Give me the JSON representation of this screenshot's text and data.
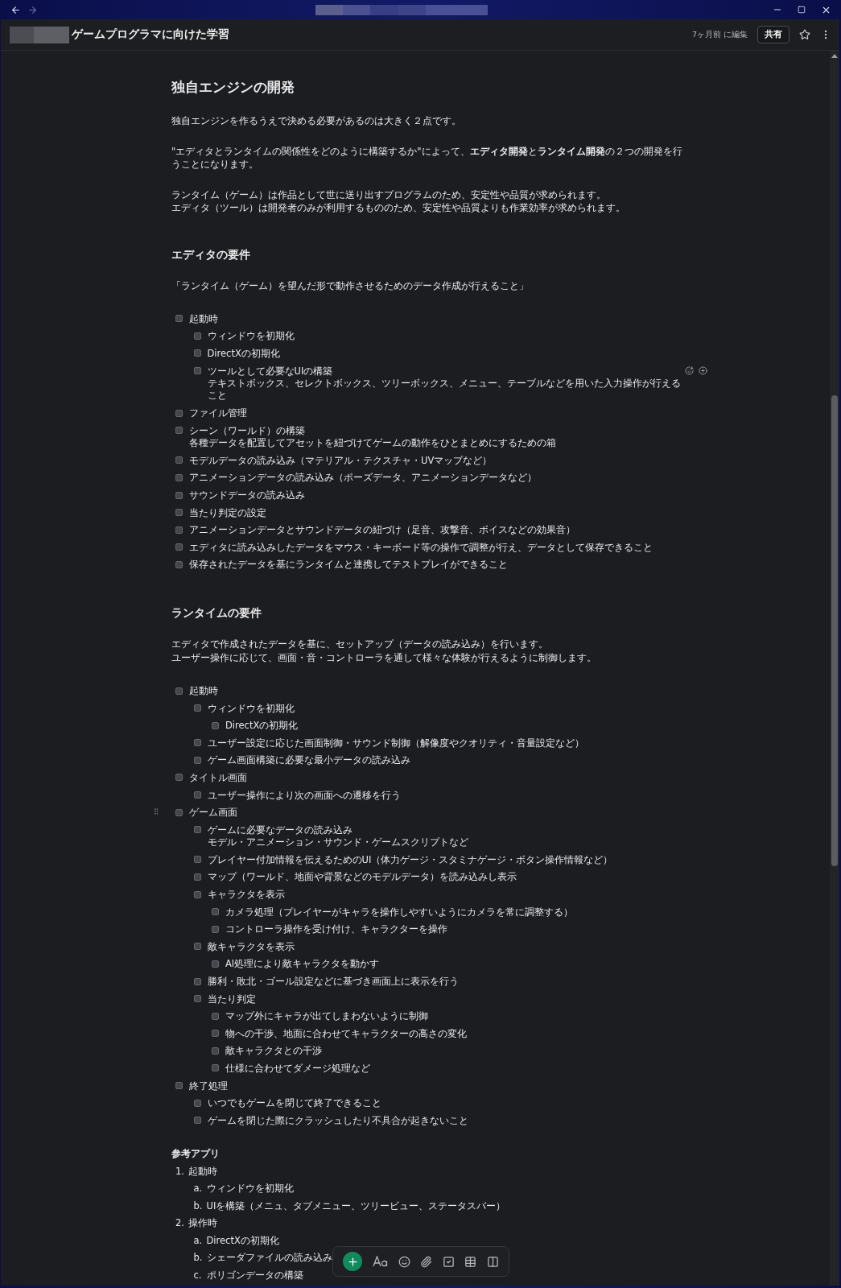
{
  "window": {
    "back_enabled": true,
    "forward_enabled": false
  },
  "header": {
    "title": "ゲームプログラマに向けた学習",
    "edited": "7ヶ月前 に編集",
    "share": "共有"
  },
  "document": {
    "blocks": [
      {
        "kind": "h1",
        "text": "独自エンジンの開発"
      },
      {
        "kind": "paragraph",
        "lines": [
          "独自エンジンを作るうえで決める必要があるのは大きく２点です。"
        ]
      },
      {
        "kind": "paragraph",
        "lines": [
          "\"エディタとランタイムの関係性をどのように構築するか\"によって、**エディタ開発**と**ランタイム開発**の２つの開発を行",
          "うことになります。"
        ]
      },
      {
        "kind": "paragraph",
        "lines": [
          "ランタイム（ゲーム）は作品として世に送り出すプログラムのため、安定性や品質が求められます。",
          "エディタ（ツール）は開発者のみが利用するもののため、安定性や品質よりも作業効率が求められます。"
        ]
      },
      {
        "kind": "h2",
        "text": "エディタの要件"
      },
      {
        "kind": "paragraph",
        "lines": [
          "「ランタイム（ゲーム）を望んだ形で動作させるためのデータ作成が行えること」"
        ]
      },
      {
        "kind": "checklist",
        "items": [
          {
            "text": "起動時",
            "checked": false,
            "children": [
              {
                "text": "ウィンドウを初期化",
                "checked": false
              },
              {
                "text": "DirectXの初期化",
                "checked": false
              },
              {
                "text": "ツールとして必要なUIの構築",
                "detail": [
                  "テキストボックス、セレクトボックス、ツリーボックス、メニュー、テーブルなどを用いた入力操作が行える",
                  "こと"
                ],
                "checked": false,
                "tools_shown": true
              }
            ]
          },
          {
            "text": "ファイル管理",
            "checked": false
          },
          {
            "text": "シーン（ワールド）の構築",
            "detail": [
              "各種データを配置してアセットを紐づけてゲームの動作をひとまとめにするための箱"
            ],
            "checked": false
          },
          {
            "text": "モデルデータの読み込み（マテリアル・テクスチャ・UVマップなど）",
            "checked": false
          },
          {
            "text": "アニメーションデータの読み込み（ポーズデータ、アニメーションデータなど）",
            "checked": false
          },
          {
            "text": "サウンドデータの読み込み",
            "checked": false
          },
          {
            "text": "当たり判定の設定",
            "checked": false
          },
          {
            "text": "アニメーションデータとサウンドデータの紐づけ（足音、攻撃音、ボイスなどの効果音）",
            "checked": false
          },
          {
            "text": "エディタに読み込みしたデータをマウス・キーボード等の操作で調整が行え、データとして保存できること",
            "checked": false
          },
          {
            "text": "保存されたデータを基にランタイムと連携してテストプレイができること",
            "checked": false
          }
        ]
      },
      {
        "kind": "h2",
        "text": "ランタイムの要件"
      },
      {
        "kind": "paragraph",
        "lines": [
          "エディタで作成されたデータを基に、セットアップ（データの読み込み）を行います。",
          "ユーザー操作に応じて、画面・音・コントローラを通して様々な体験が行えるように制御します。"
        ]
      },
      {
        "kind": "checklist",
        "items": [
          {
            "text": "起動時",
            "checked": false,
            "children": [
              {
                "text": "ウィンドウを初期化",
                "checked": false,
                "children": [
                  {
                    "text": "DirectXの初期化",
                    "checked": false
                  }
                ]
              },
              {
                "text": "ユーザー設定に応じた画面制御・サウンド制御（解像度やクオリティ・音量設定など）",
                "checked": false
              },
              {
                "text": "ゲーム画面構築に必要な最小データの読み込み",
                "checked": false
              }
            ]
          },
          {
            "text": "タイトル画面",
            "checked": false,
            "children": [
              {
                "text": "ユーザー操作により次の画面への遷移を行う",
                "checked": false
              }
            ]
          },
          {
            "text": "ゲーム画面",
            "checked": false,
            "hovered": true,
            "children": [
              {
                "text": "ゲームに必要なデータの読み込み",
                "detail": [
                  "モデル・アニメーション・サウンド・ゲームスクリプトなど"
                ],
                "checked": false
              },
              {
                "text": "プレイヤー付加情報を伝えるためのUI（体力ゲージ・スタミナゲージ・ボタン操作情報など）",
                "checked": false
              },
              {
                "text": "マップ（ワールド、地面や背景などのモデルデータ）を読み込みし表示",
                "checked": false
              },
              {
                "text": "キャラクタを表示",
                "checked": false,
                "children": [
                  {
                    "text": "カメラ処理（プレイヤーがキャラを操作しやすいようにカメラを常に調整する）",
                    "checked": false
                  },
                  {
                    "text": "コントローラ操作を受け付け、キャラクターを操作",
                    "checked": false
                  }
                ]
              },
              {
                "text": "敵キャラクタを表示",
                "checked": false,
                "children": [
                  {
                    "text": "AI処理により敵キャラクタを動かす",
                    "checked": false
                  }
                ]
              },
              {
                "text": "勝利・敗北・ゴール設定などに基づき画面上に表示を行う",
                "checked": false
              },
              {
                "text": "当たり判定",
                "checked": false,
                "children": [
                  {
                    "text": "マップ外にキャラが出てしまわないように制御",
                    "checked": false
                  },
                  {
                    "text": "物への干渉、地面に合わせてキャラクターの高さの変化",
                    "checked": false
                  },
                  {
                    "text": "敵キャラクタとの干渉",
                    "checked": false
                  },
                  {
                    "text": "仕様に合わせてダメージ処理など",
                    "checked": false
                  }
                ]
              }
            ]
          },
          {
            "text": "終了処理",
            "checked": false,
            "children": [
              {
                "text": "いつでもゲームを閉じて終了できること",
                "checked": false
              },
              {
                "text": "ゲームを閉じた際にクラッシュしたり不具合が起きないこと",
                "checked": false
              }
            ]
          }
        ]
      },
      {
        "kind": "h3",
        "text": "参考アプリ"
      },
      {
        "kind": "ordered",
        "items": [
          {
            "marker": "1.",
            "text": "起動時",
            "children": [
              {
                "marker": "a.",
                "text": "ウィンドウを初期化"
              },
              {
                "marker": "b.",
                "text": "UIを構築（メニュ、タブメニュー、ツリービュー、ステータスバー）"
              }
            ]
          },
          {
            "marker": "2.",
            "text": "操作時",
            "children": [
              {
                "marker": "a.",
                "text": "DirectXの初期化"
              },
              {
                "marker": "b.",
                "text": "シェーダファイルの読み込み"
              },
              {
                "marker": "c.",
                "text": "ポリゴンデータの構築"
              }
            ]
          }
        ]
      }
    ]
  }
}
